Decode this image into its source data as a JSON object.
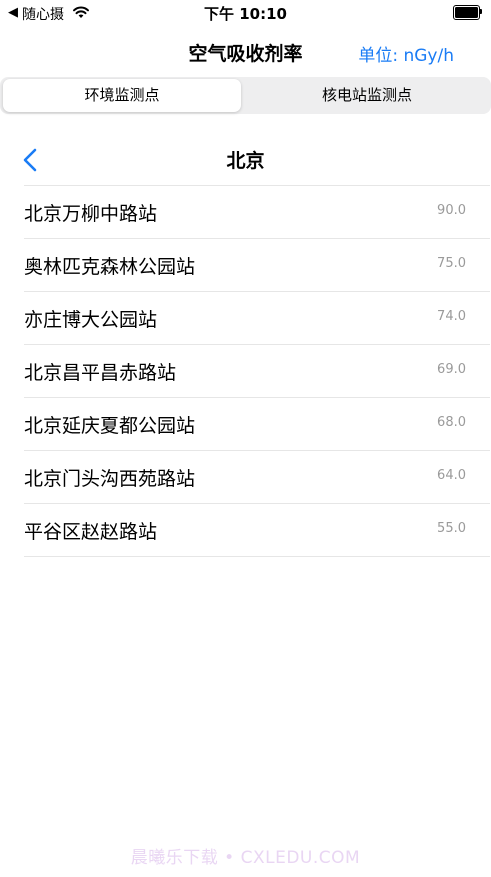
{
  "status_bar": {
    "back_symbol": "◀",
    "app_name": "随心摄",
    "time": "下午 10:10"
  },
  "nav_bar": {
    "title": "空气吸收剂率",
    "unit_label": "单位: nGy/h"
  },
  "segmented_control": {
    "tabs": [
      {
        "label": "环境监测点",
        "selected": true
      },
      {
        "label": "核电站监测点",
        "selected": false
      }
    ]
  },
  "detail": {
    "title": "北京",
    "stations": [
      {
        "name": "北京万柳中路站",
        "value": "90.0"
      },
      {
        "name": "奥林匹克森林公园站",
        "value": "75.0"
      },
      {
        "name": "亦庄博大公园站",
        "value": "74.0"
      },
      {
        "name": "北京昌平昌赤路站",
        "value": "69.0"
      },
      {
        "name": "北京延庆夏都公园站",
        "value": "68.0"
      },
      {
        "name": "北京门头沟西苑路站",
        "value": "64.0"
      },
      {
        "name": "平谷区赵赵路站",
        "value": "55.0"
      }
    ]
  },
  "watermark": "晨曦乐下载 • CXLEDU.COM",
  "colors": {
    "accent": "#1a7cf5",
    "value_gray": "#9a9a9a",
    "divider": "#e6e6e6"
  }
}
